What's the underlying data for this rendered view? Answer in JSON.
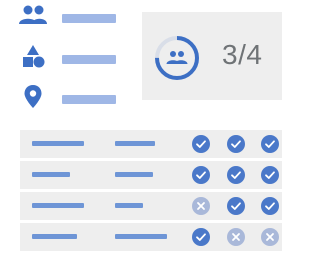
{
  "colors": {
    "icon": "#3d6fc4",
    "pill": "#9fb7e6",
    "bar": "#6e95d6",
    "card_bg": "#eeeeee",
    "row_bg": "#eeeeee",
    "check_bg": "#4a78c9",
    "cross_bg": "#a9b8d9",
    "summary_text": "#6f7376"
  },
  "legend": {
    "items": [
      {
        "icon": "people-icon"
      },
      {
        "icon": "shapes-icon"
      },
      {
        "icon": "location-pin-icon"
      }
    ]
  },
  "summary": {
    "icon": "people-icon",
    "value": "3/4",
    "progress": 0.75
  },
  "table": {
    "rows": [
      {
        "statuses": [
          "check",
          "check",
          "check"
        ]
      },
      {
        "statuses": [
          "check",
          "check",
          "check"
        ]
      },
      {
        "statuses": [
          "cross",
          "check",
          "check"
        ]
      },
      {
        "statuses": [
          "check",
          "cross",
          "cross"
        ]
      }
    ]
  }
}
